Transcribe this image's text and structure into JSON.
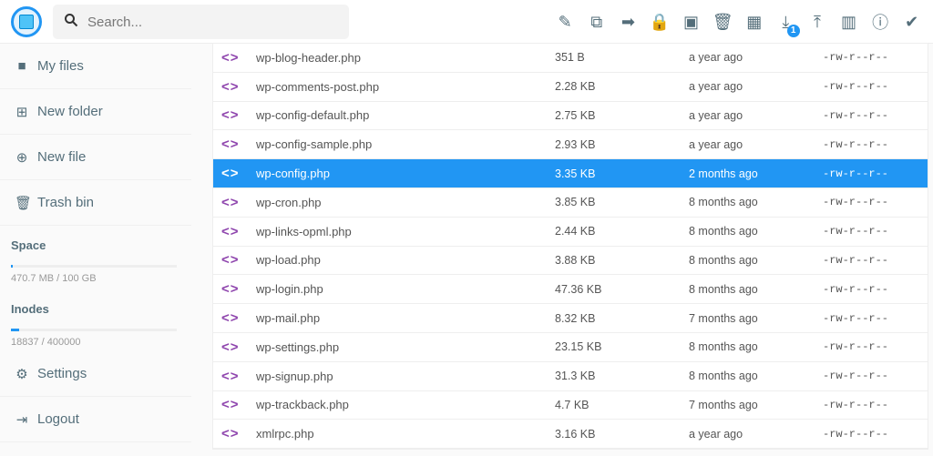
{
  "search": {
    "placeholder": "Search..."
  },
  "toolbar": [
    {
      "name": "edit",
      "glyph": "✎"
    },
    {
      "name": "copy",
      "glyph": "⧉"
    },
    {
      "name": "move",
      "glyph": "➡"
    },
    {
      "name": "permissions",
      "glyph": "🔒"
    },
    {
      "name": "archive",
      "glyph": "▣"
    },
    {
      "name": "delete",
      "glyph": "🗑"
    },
    {
      "name": "view-mode",
      "glyph": "▦"
    },
    {
      "name": "download",
      "glyph": "⤓",
      "badge": "1"
    },
    {
      "name": "upload",
      "glyph": "⤒"
    },
    {
      "name": "shell",
      "glyph": "▥"
    },
    {
      "name": "info",
      "glyph": "ⓘ"
    },
    {
      "name": "select",
      "glyph": "✔"
    }
  ],
  "sidebar": {
    "items": [
      {
        "label": "My files",
        "icon": "folder"
      },
      {
        "label": "New folder",
        "icon": "folder-plus"
      },
      {
        "label": "New file",
        "icon": "file-plus"
      },
      {
        "label": "Trash bin",
        "icon": "trash"
      }
    ],
    "space": {
      "title": "Space",
      "text": "470.7 MB / 100 GB",
      "fraction": 0.0047
    },
    "inodes": {
      "title": "Inodes",
      "text": "18837 / 400000",
      "fraction": 0.047
    },
    "bottom": [
      {
        "label": "Settings",
        "icon": "gear"
      },
      {
        "label": "Logout",
        "icon": "logout"
      }
    ]
  },
  "files": [
    {
      "name": "wp-blog-header.php",
      "size": "351 B",
      "modified": "a year ago",
      "perms": "-rw-r--r--"
    },
    {
      "name": "wp-comments-post.php",
      "size": "2.28 KB",
      "modified": "a year ago",
      "perms": "-rw-r--r--"
    },
    {
      "name": "wp-config-default.php",
      "size": "2.75 KB",
      "modified": "a year ago",
      "perms": "-rw-r--r--"
    },
    {
      "name": "wp-config-sample.php",
      "size": "2.93 KB",
      "modified": "a year ago",
      "perms": "-rw-r--r--"
    },
    {
      "name": "wp-config.php",
      "size": "3.35 KB",
      "modified": "2 months ago",
      "perms": "-rw-r--r--",
      "selected": true
    },
    {
      "name": "wp-cron.php",
      "size": "3.85 KB",
      "modified": "8 months ago",
      "perms": "-rw-r--r--"
    },
    {
      "name": "wp-links-opml.php",
      "size": "2.44 KB",
      "modified": "8 months ago",
      "perms": "-rw-r--r--"
    },
    {
      "name": "wp-load.php",
      "size": "3.88 KB",
      "modified": "8 months ago",
      "perms": "-rw-r--r--"
    },
    {
      "name": "wp-login.php",
      "size": "47.36 KB",
      "modified": "8 months ago",
      "perms": "-rw-r--r--"
    },
    {
      "name": "wp-mail.php",
      "size": "8.32 KB",
      "modified": "7 months ago",
      "perms": "-rw-r--r--"
    },
    {
      "name": "wp-settings.php",
      "size": "23.15 KB",
      "modified": "8 months ago",
      "perms": "-rw-r--r--"
    },
    {
      "name": "wp-signup.php",
      "size": "31.3 KB",
      "modified": "8 months ago",
      "perms": "-rw-r--r--"
    },
    {
      "name": "wp-trackback.php",
      "size": "4.7 KB",
      "modified": "7 months ago",
      "perms": "-rw-r--r--"
    },
    {
      "name": "xmlrpc.php",
      "size": "3.16 KB",
      "modified": "a year ago",
      "perms": "-rw-r--r--"
    }
  ]
}
